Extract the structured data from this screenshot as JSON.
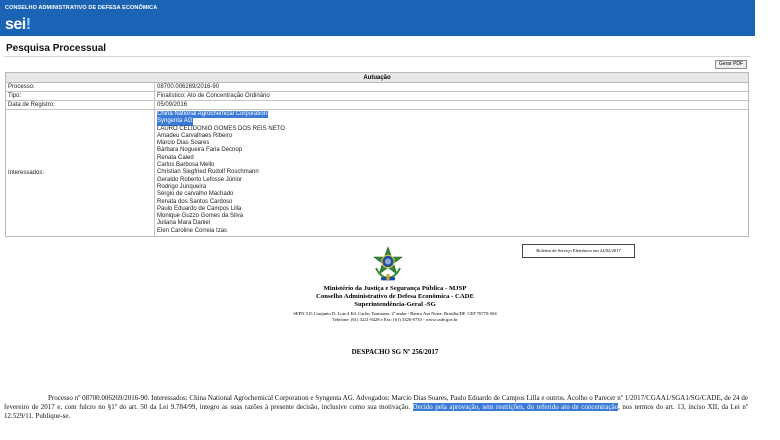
{
  "header": {
    "org_name": "CONSELHO ADMINISTRATIVO DE DEFESA ECONÔMICA",
    "logo_text": "sei",
    "logo_mark": "!",
    "brand_color": "#1a63b5"
  },
  "page": {
    "title": "Pesquisa Processual",
    "pdf_button_label": "Gerar PDF"
  },
  "autuacao": {
    "header": "Autuação",
    "rows": [
      {
        "label": "Processo:",
        "value": "08700.006269/2016-90"
      },
      {
        "label": "Tipo:",
        "value": "Finalístico: Ato de Concentração Ordinário"
      },
      {
        "label": "Data de Registro:",
        "value": "05/09/2016"
      }
    ],
    "interessados_label": "Interessados:",
    "interessados": [
      "China National Agrochemical Corporation",
      "Syngenta AG",
      "LAURO CELIDONIO GOMES DOS REIS NETO",
      "Amadeu Carvalhaes Ribeiro",
      "Marcio Dias Soares",
      "Bárbara Nogueira Faria Decnop",
      "Renata Caied",
      "Carlos Barbosa Mello",
      "Christian Siegfried Rudolf Roschmann",
      "Geraldo Roberto Lefosse Júnior",
      "Rodrigo Junqueira",
      "Sérgio de carvalho Machado",
      "Renata dos Santos Cardoso",
      "Paulo Eduardo de Campos Lilla",
      "Monique Guzzo Gomes da Silva",
      "Juliana Mara Daniel",
      "Elen Caroline Correia Izas"
    ]
  },
  "document": {
    "boletim": "Boletim de Serviço Eletrônico em 24/02/2017",
    "ministry": "Ministério da Justiça e Segurança Pública - MJSP",
    "council": "Conselho Administrativo de Defesa Econômica - CADE",
    "superintendence": "Superintendência-Geral -SG",
    "address": "SEPN 515 Conjunto D, Lote 4 Ed. Carlos Taurisano, 2º andar - Bairro Asa Norte, Brasília/DF, CEP 70770-504",
    "phone": "Telefone: (61) 3221-8428 e Fax: (61) 3326-9733 - www.cade.gov.br",
    "despacho_title": "DESPACHO SG Nº 256/2017",
    "body_part1": "Processo nº 08700.006269/2016-90. Interessados: China National Agrochemical Corporatıon e Syngenta AG. Advogados: Marcio Dias Soares, Paulo Eduardo de Campos Lilla e outros. Acolho o Parecer nº 1/2017/CGAA1/SGA1/SG/CADE, de 24 de fevereiro de 2017 e, com fulcro no §1º do art. 50 da Lei 9.784/99, integro as suas razões à presente decisão, inclusive como sua motivação. ",
    "body_highlight": "Decido pela aprovação, sem restrições, do referido ato de concentração",
    "body_part2": ", nos termos do art. 13, inciso XII, da Lei nº 12.529/11.  Publique-se."
  }
}
